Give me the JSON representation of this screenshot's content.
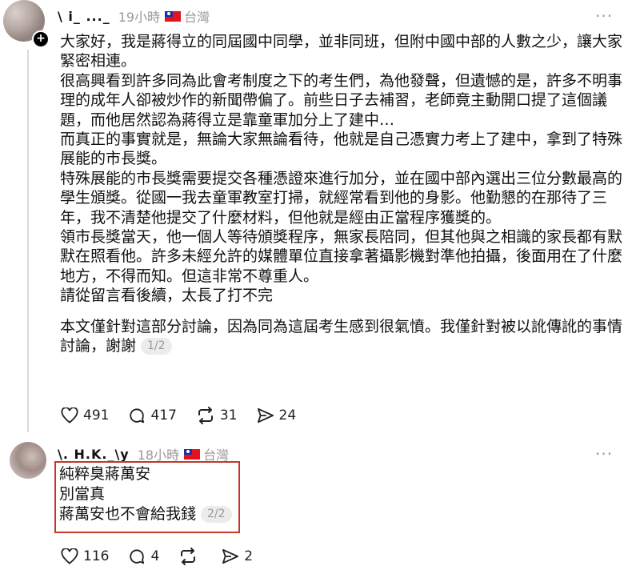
{
  "post": {
    "username": "\\ i_ ..._",
    "time": "19小時",
    "location": "台灣",
    "paragraphs": [
      "大家好，我是蔣得立的同屆國中同學，並非同班，但附中國中部的人數之少，讓大家緊密相連。",
      "很高興看到許多同為此會考制度之下的考生們，為他發聲，但遺憾的是，許多不明事理的成年人卻被炒作的新聞帶偏了。前些日子去補習，老師竟主動開口提了這個議題，而他居然認為蔣得立是靠童軍加分上了建中…",
      "而真正的事實就是，無論大家無論看待，他就是自己憑實力考上了建中，拿到了特殊展能的市長獎。",
      "特殊展能的市長獎需要提交各種憑證來進行加分，並在國中部內選出三位分數最高的學生頒獎。從國一我去童軍教室打掃，就經常看到他的身影。他勤懇的在那待了三年，我不清楚他提交了什麼材料，但他就是經由正當程序獲獎的。",
      "領市長獎當天，他一個人等待頒獎程序，無家長陪同，但其他與之相識的家長都有默默在照看他。許多未經允許的媒體單位直接拿著攝影機對準他拍攝，後面用在了什麼地方，不得而知。但這非常不尊重人。",
      "請從留言看後續，太長了打不完"
    ],
    "final_paragraph": "本文僅針對這部分討論，因為同為這屆考生感到很氣憤。我僅針對被以訛傳訛的事情討論，謝謝",
    "page_indicator": "1/2",
    "likes": "491",
    "comments": "417",
    "reposts": "31",
    "shares": "24"
  },
  "reply": {
    "username": "\\. H.K._\\y",
    "time": "18小時",
    "location": "台灣",
    "lines": [
      "純粹臭蔣萬安",
      "別當真",
      "蔣萬安也不會給我錢"
    ],
    "page_indicator": "2/2",
    "likes": "116",
    "comments": "4",
    "reposts": "",
    "shares": "2"
  },
  "icons": {
    "more": "more-icon",
    "like": "heart-icon",
    "comment": "comment-icon",
    "repost": "repost-icon",
    "share": "share-icon"
  },
  "colors": {
    "highlight_border": "#c0392b",
    "flag_red": "#e0141e",
    "flag_blue": "#1b2fa3"
  }
}
